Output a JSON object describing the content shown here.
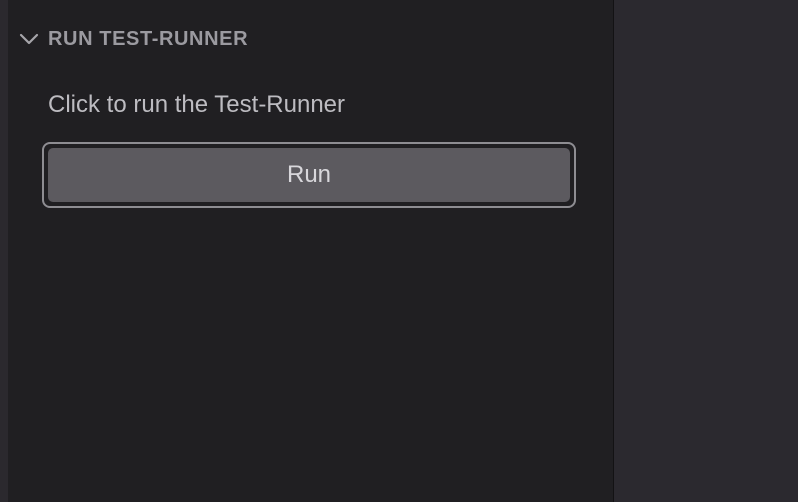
{
  "panel": {
    "section_title": "RUN TEST-RUNNER",
    "chevron_icon": "chevron-down-icon",
    "hint": "Click to run the Test-Runner",
    "run_button_label": "Run"
  },
  "colors": {
    "panel_bg": "#201f22",
    "editor_bg": "#2b292f",
    "button_bg": "#5c5a5f",
    "button_border": "#8e8d92",
    "header_text": "#9b9aa0"
  }
}
